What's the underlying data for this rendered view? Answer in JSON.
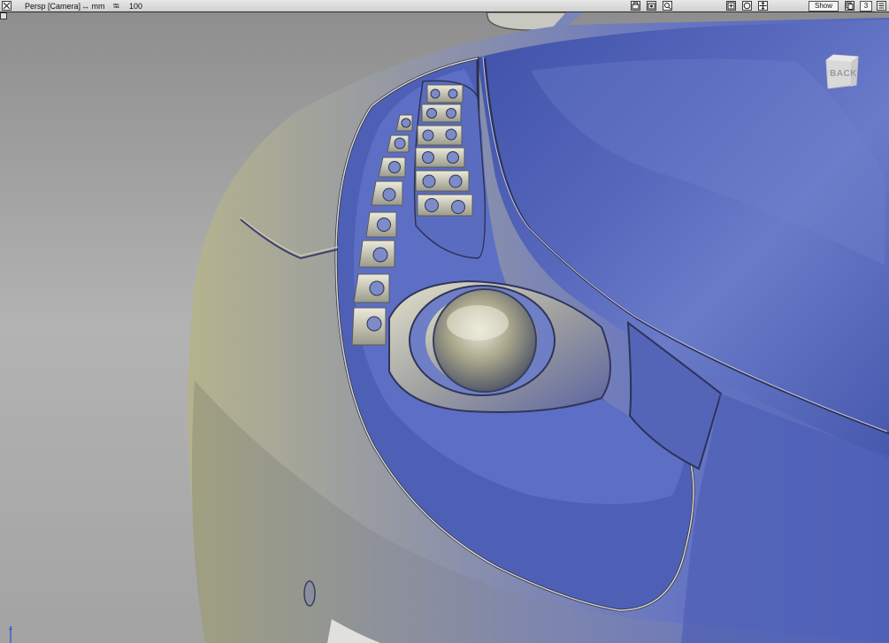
{
  "toolbar": {
    "view_label": "Persp [Camera]",
    "units_label": "↔ mm",
    "grid_label": "100",
    "show_button": "Show",
    "layer_count": "3"
  },
  "viewport": {
    "back_label": "BACK"
  },
  "colors": {
    "car_blue": "#5464b8",
    "car_highlight": "#8c9ae0",
    "chrome": "#c9c6a8",
    "background": "#a9a9a9"
  }
}
